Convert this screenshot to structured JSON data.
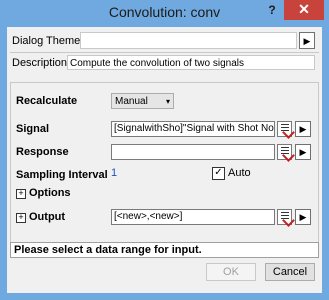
{
  "window": {
    "title": "Convolution: conv",
    "help": "?",
    "close": "✕"
  },
  "theme": {
    "label": "Dialog Theme",
    "value": "",
    "arrow": "▶"
  },
  "description": {
    "label": "Description",
    "text": "Compute the convolution of two signals"
  },
  "recalculate": {
    "label": "Recalculate",
    "value": "Manual",
    "dropdown": "▾"
  },
  "signal": {
    "label": "Signal",
    "value": "[SignalwithSho]\"Signal with Shot Noise\"!E"
  },
  "response": {
    "label": "Response",
    "value": ""
  },
  "sampling": {
    "label": "Sampling Interval",
    "value": "1",
    "auto_label": "Auto",
    "auto_checked": "✓"
  },
  "options": {
    "label": "Options",
    "expander": "+"
  },
  "output": {
    "label": "Output",
    "expander": "+",
    "value": "[<new>,<new>]"
  },
  "status": "Please select a data range for input.",
  "buttons": {
    "ok": "OK",
    "cancel": "Cancel",
    "arrow": "▶"
  }
}
